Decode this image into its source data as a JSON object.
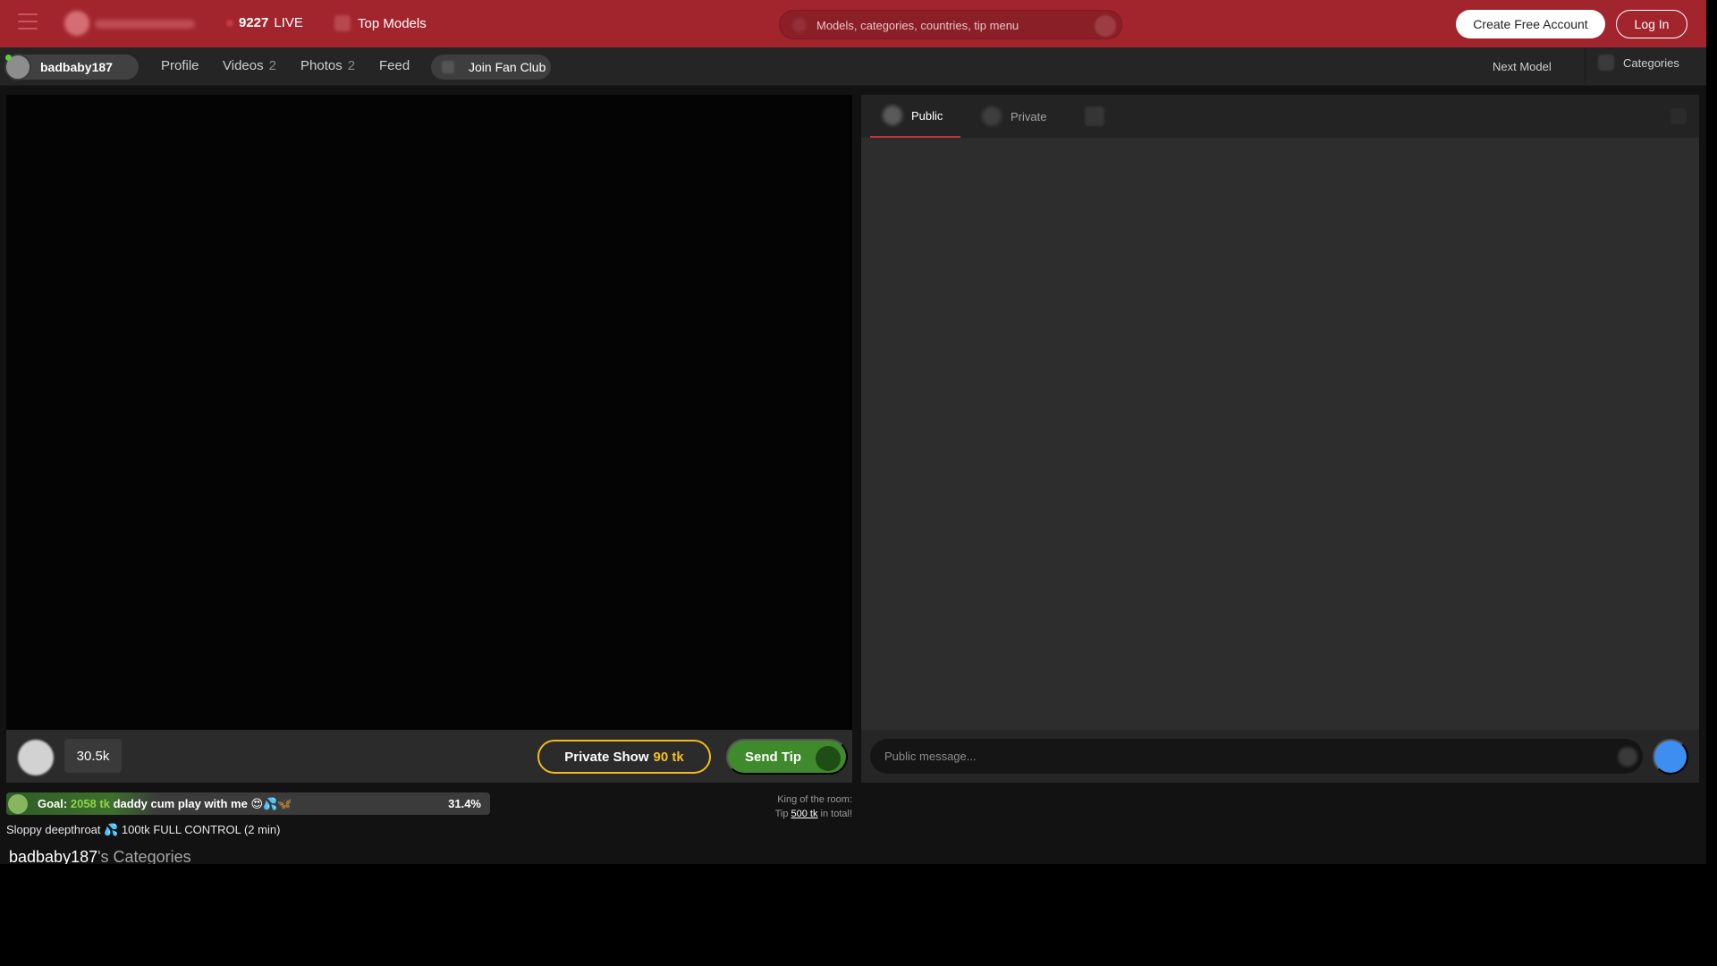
{
  "header": {
    "live_count": "9227",
    "live_label": "LIVE",
    "top_models": "Top Models",
    "search_placeholder": "Models, categories, countries, tip menu",
    "create_account": "Create Free Account",
    "login": "Log In",
    "brand_color": "#a2252e"
  },
  "model_nav": {
    "username": "badbaby187",
    "online": true,
    "tabs": [
      {
        "label": "Profile",
        "count": ""
      },
      {
        "label": "Videos",
        "count": "2"
      },
      {
        "label": "Photos",
        "count": "2"
      },
      {
        "label": "Feed",
        "count": ""
      }
    ],
    "join_fan_club": "Join Fan Club",
    "next_model": "Next Model",
    "categories": "Categories"
  },
  "video_bar": {
    "viewers": "30.5k",
    "private_show_label": "Private Show",
    "private_show_price": "90 tk",
    "send_tip": "Send Tip"
  },
  "goal": {
    "label": "Goal:",
    "amount": "2058 tk",
    "text": "daddy cum play with me 😍💦🦋",
    "percent_text": "31.4%",
    "progress_fraction": 0.314
  },
  "topic": "Sloppy deepthroat 💦 100tk FULL CONTROL (2 min)",
  "king": {
    "line1": "King of the room:",
    "tip_label": "Tip",
    "amount": "500 tk",
    "suffix": "in total!"
  },
  "categories_section": {
    "username": "badbaby187",
    "suffix": "'s Categories"
  },
  "chat": {
    "tab_public": "Public",
    "tab_private": "Private",
    "input_placeholder": "Public message...",
    "accent_underline": "#c7333c",
    "send_button_color": "#3e8df0"
  },
  "colors": {
    "private_show_border": "#f0bc1a",
    "send_tip_bg": "#3f8a2c",
    "goal_amount": "#8fd44a"
  }
}
